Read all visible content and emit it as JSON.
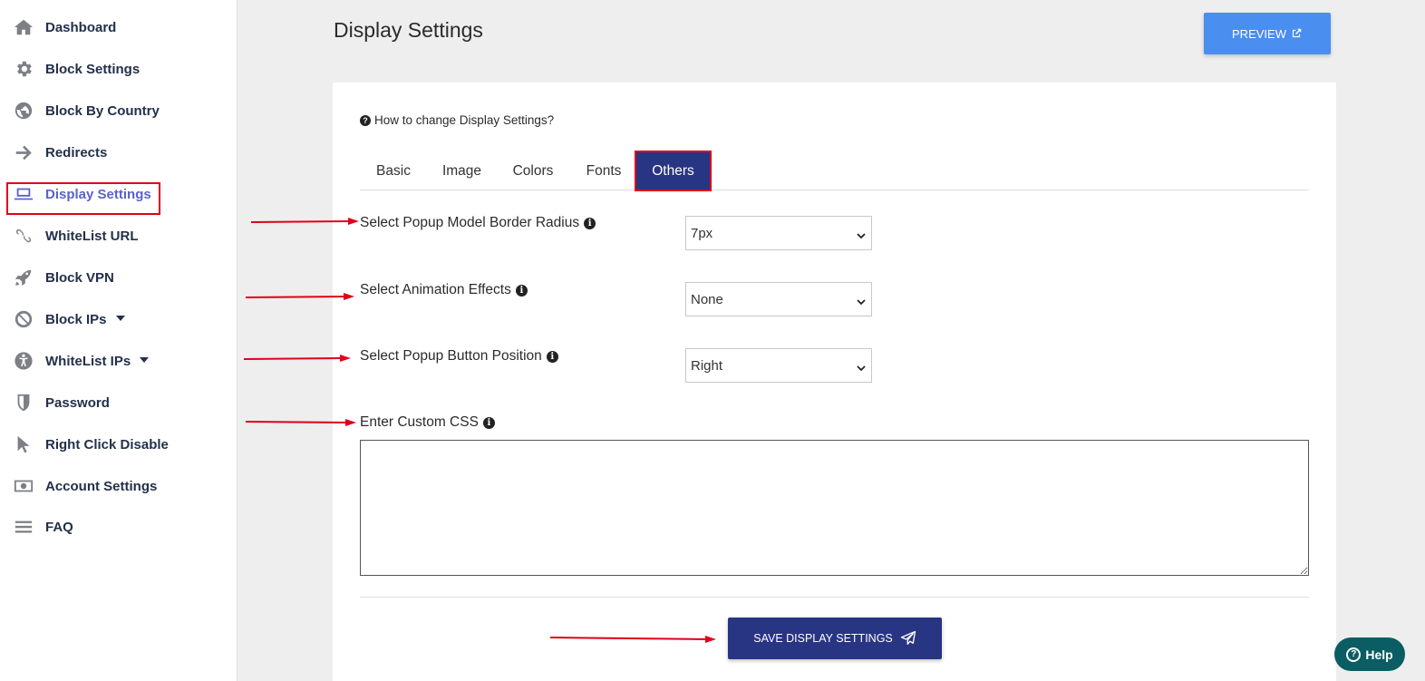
{
  "sidebar": {
    "items": [
      {
        "label": "Dashboard",
        "icon": "home-icon"
      },
      {
        "label": "Block Settings",
        "icon": "gear-icon"
      },
      {
        "label": "Block By Country",
        "icon": "globe-icon"
      },
      {
        "label": "Redirects",
        "icon": "arrow-right-icon"
      },
      {
        "label": "Display Settings",
        "icon": "laptop-icon"
      },
      {
        "label": "WhiteList URL",
        "icon": "link-icon"
      },
      {
        "label": "Block VPN",
        "icon": "rocket-icon"
      },
      {
        "label": "Block IPs",
        "icon": "ban-icon"
      },
      {
        "label": "WhiteList IPs",
        "icon": "accessibility-icon"
      },
      {
        "label": "Password",
        "icon": "shield-icon"
      },
      {
        "label": "Right Click Disable",
        "icon": "cursor-icon"
      },
      {
        "label": "Account Settings",
        "icon": "money-icon"
      },
      {
        "label": "FAQ",
        "icon": "bars-icon"
      }
    ],
    "active": "Display Settings"
  },
  "header": {
    "title": "Display Settings",
    "preview_label": "PREVIEW"
  },
  "card": {
    "help_link": "How to change Display Settings?",
    "tabs": [
      "Basic",
      "Image",
      "Colors",
      "Fonts",
      "Others"
    ],
    "active_tab": "Others",
    "fields": {
      "border_radius": {
        "label": "Select Popup Model Border Radius",
        "value": "7px"
      },
      "animation": {
        "label": "Select Animation Effects",
        "value": "None"
      },
      "button_position": {
        "label": "Select Popup Button Position",
        "value": "Right"
      },
      "custom_css": {
        "label": "Enter Custom CSS",
        "value": ""
      }
    },
    "save_label": "SAVE DISPLAY SETTINGS"
  },
  "help_widget": {
    "label": "Help"
  },
  "colors": {
    "primary": "#283583",
    "preview": "#4a8ef0",
    "annotation": "#e0001a",
    "help_widget": "#0a5d63"
  }
}
